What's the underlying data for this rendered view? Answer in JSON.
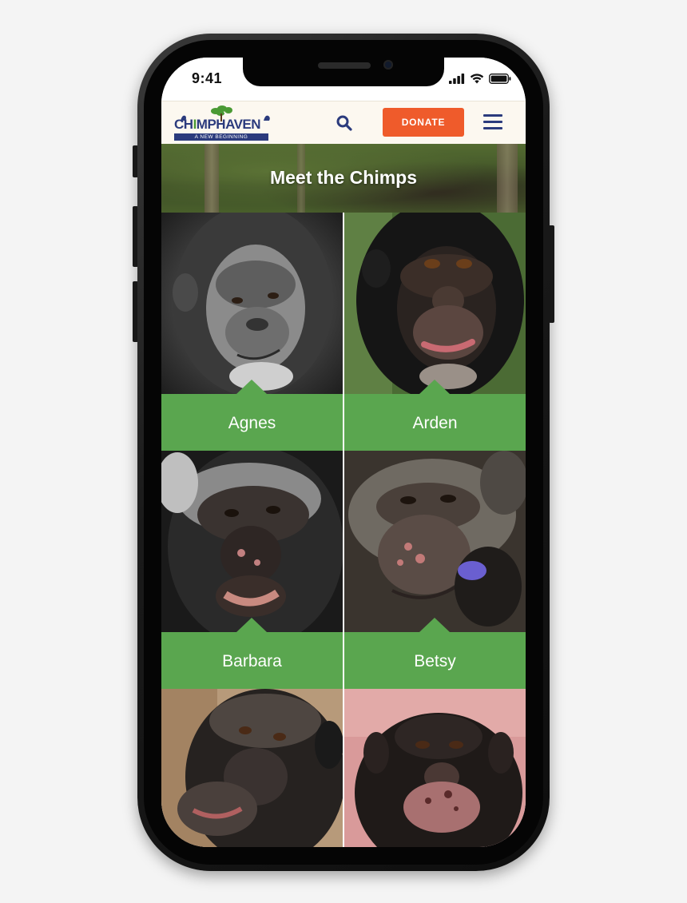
{
  "status_bar": {
    "time": "9:41",
    "icons": [
      "cellular-signal-icon",
      "wifi-icon",
      "battery-icon"
    ]
  },
  "header": {
    "logo_text_part1": "CH",
    "logo_text_part2": "MPHAVEN",
    "logo_tagline": "A NEW BEGINNING",
    "search_icon": "search-icon",
    "donate_label": "DONATE",
    "menu_icon": "hamburger-menu-icon"
  },
  "hero": {
    "title": "Meet the Chimps"
  },
  "chimps": [
    {
      "name": "Agnes"
    },
    {
      "name": "Arden"
    },
    {
      "name": "Barbara"
    },
    {
      "name": "Betsy"
    },
    {
      "name": ""
    },
    {
      "name": ""
    }
  ],
  "colors": {
    "brand_navy": "#2b3b7d",
    "brand_green": "#4a9a34",
    "donate_orange": "#ef5b2b",
    "label_green": "#5aa64f",
    "header_bg": "#fcf8f0"
  }
}
